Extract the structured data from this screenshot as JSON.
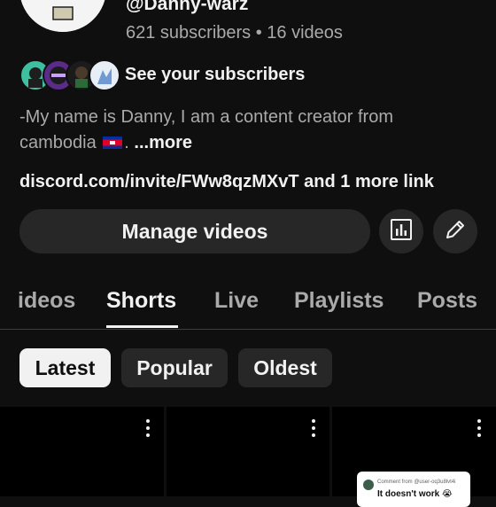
{
  "channel": {
    "handle": "@Danny-warz",
    "stats": "621 subscribers • 16 videos"
  },
  "subscribers": {
    "link_label": "See your subscribers"
  },
  "description": {
    "text": "-My name is Danny, I am a content creator from cambodia ",
    "suffix": ". ",
    "more_label": "...more"
  },
  "links": {
    "primary": "discord.com/invite/FWw8qzMXvT",
    "more": " and 1 more link"
  },
  "actions": {
    "manage_label": "Manage videos",
    "analytics_icon": "analytics-icon",
    "edit_icon": "pencil-icon"
  },
  "tabs": [
    {
      "label": "ideos",
      "active": false
    },
    {
      "label": "Shorts",
      "active": true
    },
    {
      "label": "Live",
      "active": false
    },
    {
      "label": "Playlists",
      "active": false
    },
    {
      "label": "Posts",
      "active": false
    }
  ],
  "filters": [
    {
      "label": "Latest",
      "active": true
    },
    {
      "label": "Popular",
      "active": false
    },
    {
      "label": "Oldest",
      "active": false
    }
  ],
  "shorts": {
    "comment_from": "Comment from @user-oq3u8lvt4i",
    "comment_text": "It doesn't work 😭"
  },
  "colors": {
    "background": "#0f0f0f",
    "surface": "#272727",
    "text_primary": "#f1f1f1",
    "text_secondary": "#aaaaaa"
  }
}
